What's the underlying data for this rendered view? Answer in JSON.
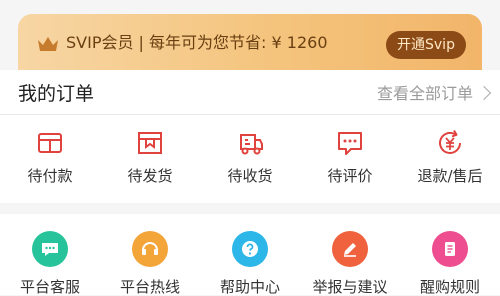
{
  "vip_banner": {
    "text": "SVIP会员 | 每年可为您节省: ¥ 1260",
    "button_label": "开通Svip"
  },
  "orders": {
    "title": "我的订单",
    "view_all": "查看全部订单",
    "items": [
      {
        "label": "待付款",
        "icon": "wallet-icon"
      },
      {
        "label": "待发货",
        "icon": "package-icon"
      },
      {
        "label": "待收货",
        "icon": "delivery-truck-icon"
      },
      {
        "label": "待评价",
        "icon": "comment-icon"
      },
      {
        "label": "退款/售后",
        "icon": "refund-icon"
      }
    ]
  },
  "services": {
    "items": [
      {
        "label": "平台客服",
        "icon": "chat-bubble-icon",
        "color": "#27c49b"
      },
      {
        "label": "平台热线",
        "icon": "headset-icon",
        "color": "#f3a53a"
      },
      {
        "label": "帮助中心",
        "icon": "help-icon",
        "color": "#2db6e8"
      },
      {
        "label": "举报与建议",
        "icon": "pencil-icon",
        "color": "#f0623d"
      },
      {
        "label": "醒购规则",
        "icon": "document-icon",
        "color": "#ee4d8f"
      }
    ]
  },
  "colors": {
    "accent_red": "#e0433e",
    "banner_text": "#6a3f12",
    "svip_button_bg": "#8b4a16"
  }
}
